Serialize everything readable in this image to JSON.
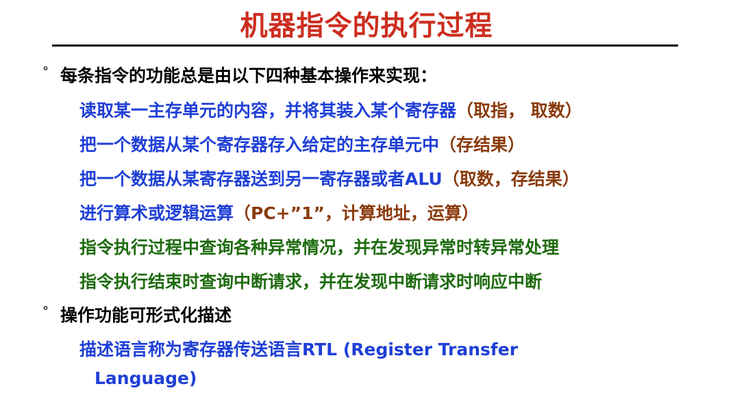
{
  "title": "机器指令的执行过程",
  "bullet_symbol": "°",
  "bullet1": "每条指令的功能总是由以下四种基本操作来实现：",
  "items": [
    {
      "main": "读取某一主存单元的内容，并将其装入某个寄存器",
      "paren": "（取指， 取数）"
    },
    {
      "main": "把一个数据从某个寄存器存入给定的主存单元中",
      "paren": "（存结果）"
    },
    {
      "main": "把一个数据从某寄存器送到另一寄存器或者ALU",
      "paren": "（取数，存结果）"
    },
    {
      "main": "进行算术或逻辑运算",
      "paren": "（PC+”1”，计算地址，运算）"
    },
    {
      "main": "指令执行过程中查询各种异常情况，并在发现异常时转异常处理",
      "paren": ""
    },
    {
      "main": "指令执行结束时查询中断请求，并在发现中断请求时响应中断",
      "paren": ""
    }
  ],
  "bullet2": "操作功能可形式化描述",
  "rtl_line1": "描述语言称为寄存器传送语言RTL (Register Transfer",
  "rtl_line2": "Language)",
  "colors": {
    "title": "#cc2e1f",
    "black": "#000000",
    "blue": "#1f3fd6",
    "brown": "#8a3a0c",
    "green": "#1f6b10"
  }
}
